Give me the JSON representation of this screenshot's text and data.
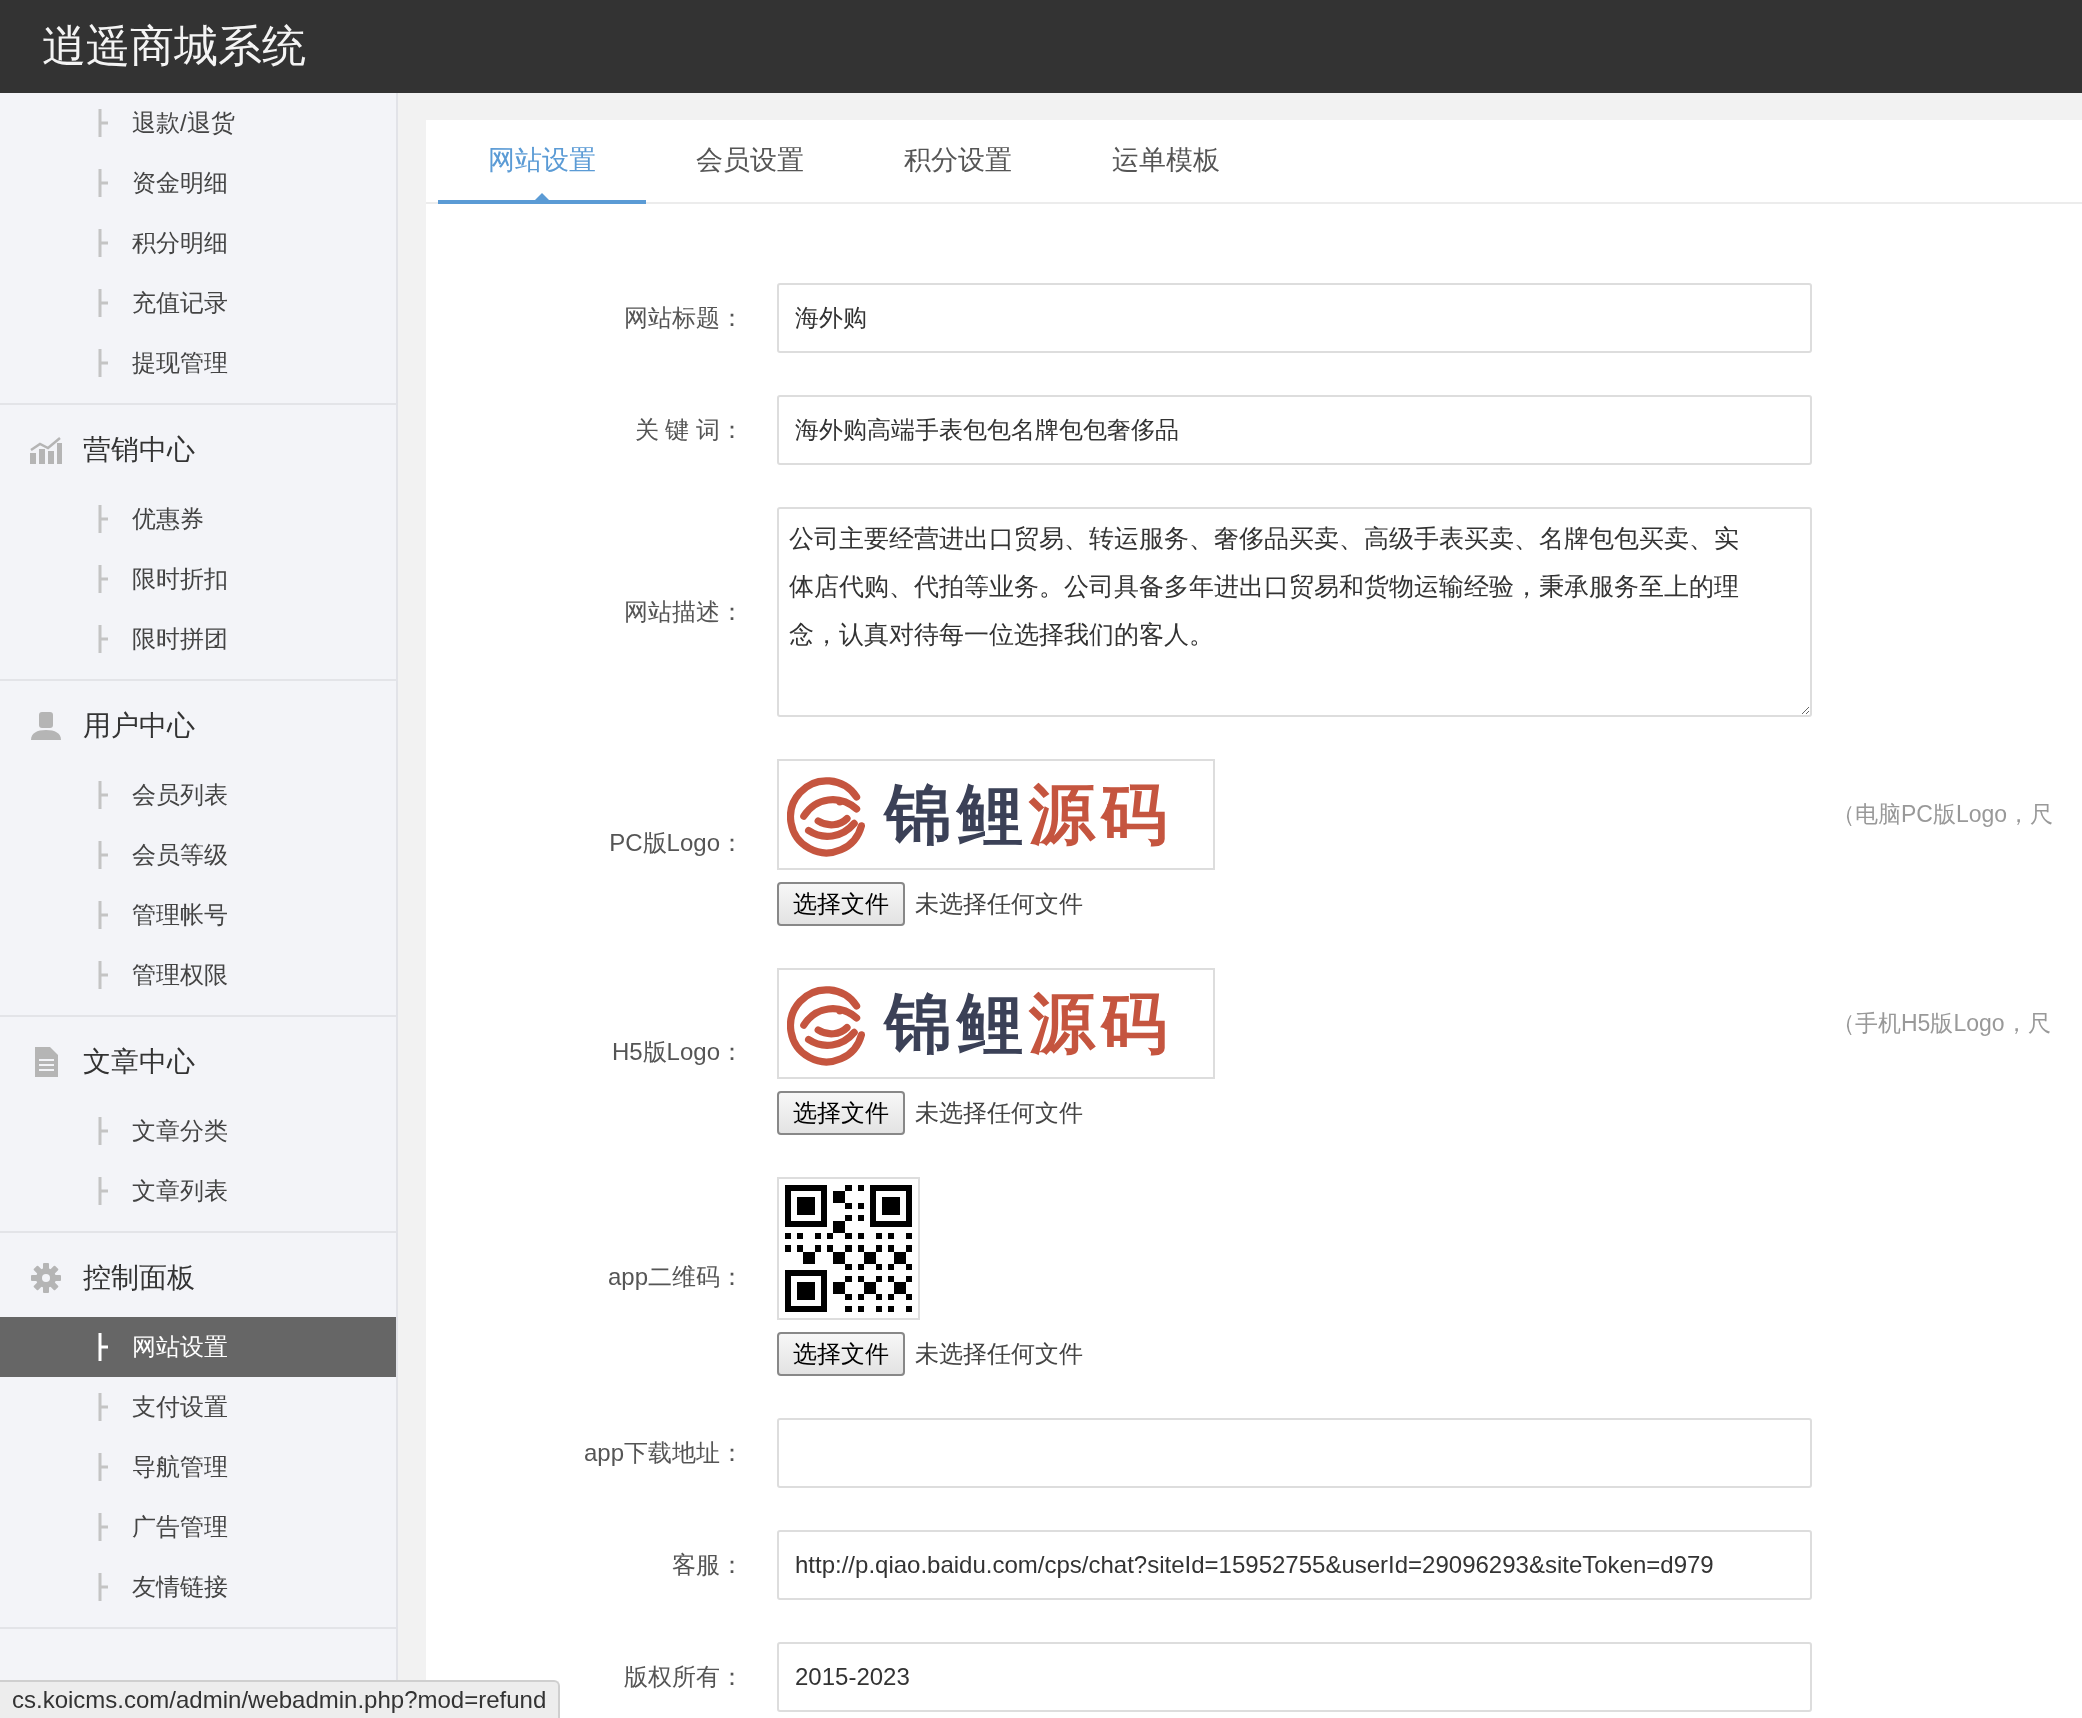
{
  "header": {
    "title": "逍遥商城系统"
  },
  "sidebar": {
    "sections": [
      {
        "items": [
          {
            "label": "退款/退货",
            "selected": false
          },
          {
            "label": "资金明细",
            "selected": false
          },
          {
            "label": "积分明细",
            "selected": false
          },
          {
            "label": "充值记录",
            "selected": false
          },
          {
            "label": "提现管理",
            "selected": false
          }
        ]
      },
      {
        "title": "营销中心",
        "items": [
          {
            "label": "优惠券",
            "selected": false
          },
          {
            "label": "限时折扣",
            "selected": false
          },
          {
            "label": "限时拼团",
            "selected": false
          }
        ]
      },
      {
        "title": "用户中心",
        "items": [
          {
            "label": "会员列表",
            "selected": false
          },
          {
            "label": "会员等级",
            "selected": false
          },
          {
            "label": "管理帐号",
            "selected": false
          },
          {
            "label": "管理权限",
            "selected": false
          }
        ]
      },
      {
        "title": "文章中心",
        "items": [
          {
            "label": "文章分类",
            "selected": false
          },
          {
            "label": "文章列表",
            "selected": false
          }
        ]
      },
      {
        "title": "控制面板",
        "items": [
          {
            "label": "网站设置",
            "selected": true
          },
          {
            "label": "支付设置",
            "selected": false
          },
          {
            "label": "导航管理",
            "selected": false
          },
          {
            "label": "广告管理",
            "selected": false
          },
          {
            "label": "友情链接",
            "selected": false
          }
        ]
      }
    ]
  },
  "tabs": [
    {
      "label": "网站设置",
      "selected": true
    },
    {
      "label": "会员设置",
      "selected": false
    },
    {
      "label": "积分设置",
      "selected": false
    },
    {
      "label": "运单模板",
      "selected": false
    }
  ],
  "form": {
    "rows": [
      {
        "kind": "text",
        "label": "网站标题：",
        "value": "海外购"
      },
      {
        "kind": "text",
        "label": "关 键 词：",
        "value": "海外购高端手表包包名牌包包奢侈品"
      },
      {
        "kind": "textarea",
        "label": "网站描述：",
        "value": "公司主要经营进出口贸易、转运服务、奢侈品买卖、高级手表买卖、名牌包包买卖、实体店代购、代拍等业务。公司具备多年进出口贸易和货物运输经验，秉承服务至上的理念，认真对待每一位选择我们的客人。"
      },
      {
        "kind": "image",
        "label": "PC版Logo：",
        "preview": {
          "kind": "logo",
          "words": [
            "锦鲤",
            "源码"
          ]
        },
        "button": "选择文件",
        "file_status": "未选择任何文件",
        "hint": "（电脑PC版Logo，尺"
      },
      {
        "kind": "image",
        "label": "H5版Logo：",
        "preview": {
          "kind": "logo",
          "words": [
            "锦鲤",
            "源码"
          ]
        },
        "button": "选择文件",
        "file_status": "未选择任何文件",
        "hint": "（手机H5版Logo，尺"
      },
      {
        "kind": "image",
        "label": "app二维码：",
        "preview": {
          "kind": "qr"
        },
        "button": "选择文件",
        "file_status": "未选择任何文件"
      },
      {
        "kind": "text",
        "label": "app下载地址："
      },
      {
        "kind": "text",
        "label": "客服：",
        "value": "http://p.qiao.baidu.com/cps/chat?siteId=15952755&userId=29096293&siteToken=d979"
      },
      {
        "kind": "text",
        "label": "版权所有：",
        "value": "2015-2023"
      }
    ]
  },
  "status_bar": {
    "url": "cs.koicms.com/admin/webadmin.php?mod=refund"
  }
}
